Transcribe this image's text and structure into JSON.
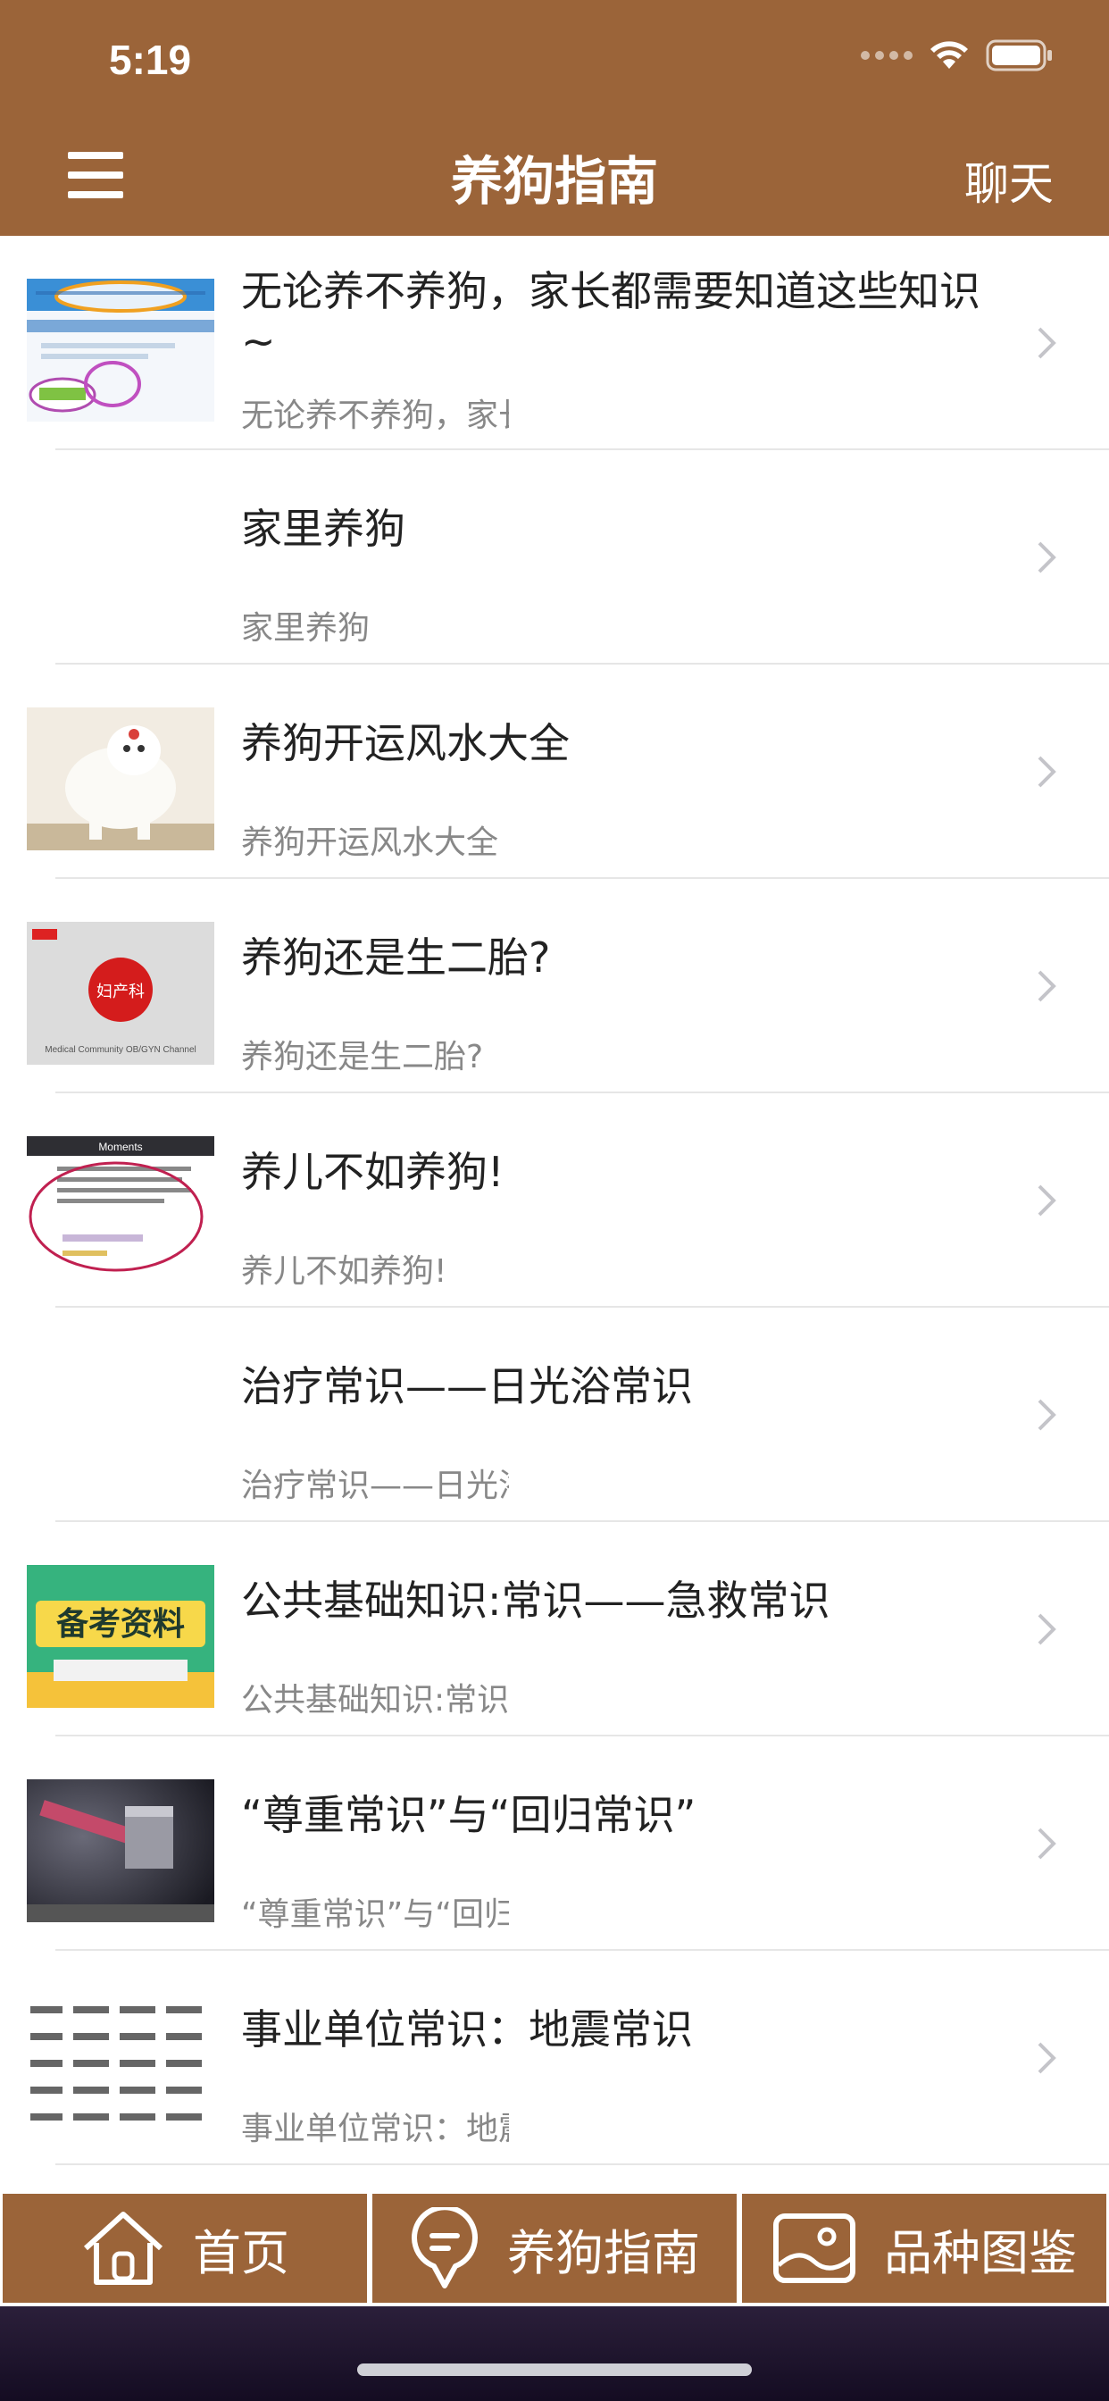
{
  "status": {
    "time": "5:19"
  },
  "nav": {
    "title": "养狗指南",
    "right_label": "聊天"
  },
  "rows": [
    {
      "title": "无论养不养狗，家长都需要知道这些知识~",
      "subtitle": "无论养不养狗，家长",
      "thumb": "website-screenshot"
    },
    {
      "title": "家里养狗",
      "subtitle": "家里养狗",
      "thumb": "none"
    },
    {
      "title": "养狗开运风水大全",
      "subtitle": "养狗开运风水大全",
      "thumb": "white-poodle-photo"
    },
    {
      "title": "养狗还是生二胎?",
      "subtitle": "养狗还是生二胎?",
      "thumb": "medical-channel-logo"
    },
    {
      "title": "养儿不如养狗!",
      "subtitle": "养儿不如养狗!",
      "thumb": "moments-screenshot"
    },
    {
      "title": "治疗常识——日光浴常识",
      "subtitle": "治疗常识——日光浴",
      "thumb": "none"
    },
    {
      "title": "公共基础知识:常识——急救常识",
      "subtitle": "公共基础知识:常识",
      "thumb": "exam-material-banner"
    },
    {
      "title": "“尊重常识”与“回归常识”",
      "subtitle": "“尊重常识”与“回归",
      "thumb": "hammer-photo"
    },
    {
      "title": "事业单位常识：地震常识",
      "subtitle": "事业单位常识：地震",
      "thumb": "text-grid"
    }
  ],
  "thumb_texts": {
    "medical_logo_text": "妇产科",
    "medical_caption": "Medical Community OB/GYN Channel",
    "moments_header": "Moments",
    "exam_banner": "备考资料"
  },
  "tabs": [
    {
      "label": "首页",
      "icon": "home-icon"
    },
    {
      "label": "养狗指南",
      "icon": "guide-pin-icon"
    },
    {
      "label": "品种图鉴",
      "icon": "picture-icon"
    }
  ],
  "colors": {
    "brand": "#9b6439",
    "title_text": "#222222",
    "subtitle_text": "#888888"
  }
}
